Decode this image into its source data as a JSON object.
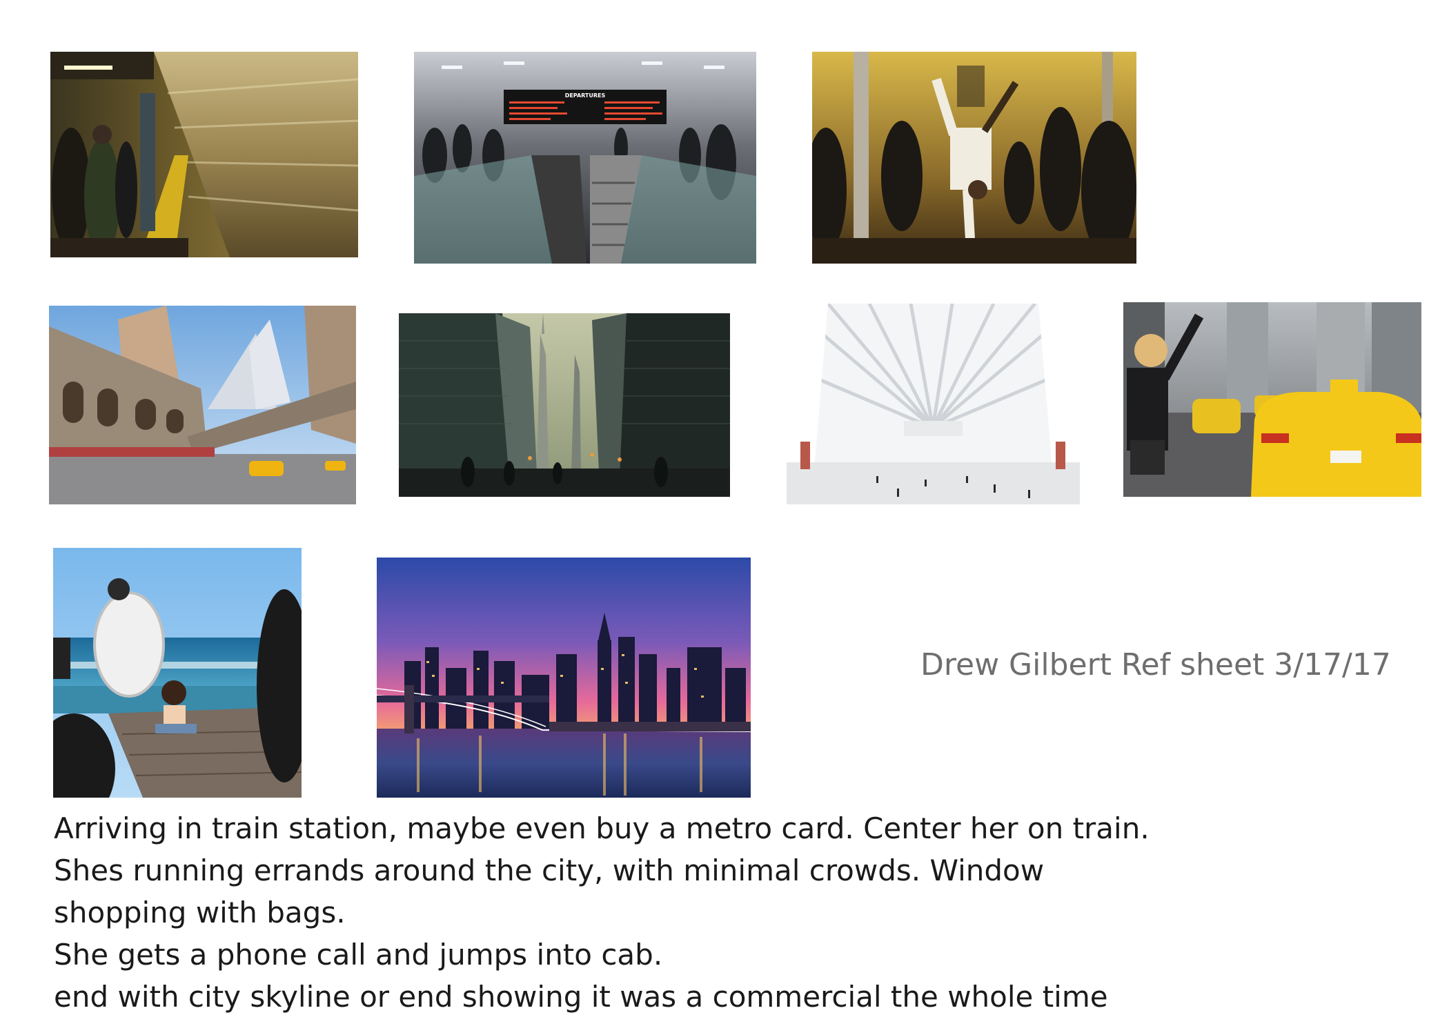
{
  "sheet": {
    "ref_title": "Drew Gilbert Ref sheet 3/17/17",
    "notes": [
      "Arriving in train station, maybe even buy a metro card. Center her on train.",
      "Shes running errands around the city, with minimal crowds. Window",
      "shopping with bags.",
      "She gets a phone call and jumps into cab.",
      "end with city skyline or end showing it was a commercial the whole time"
    ],
    "photos": {
      "departures_board_text": "DEPARTURES"
    }
  }
}
